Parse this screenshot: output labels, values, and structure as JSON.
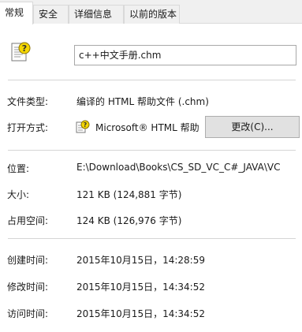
{
  "tabs": [
    "常规",
    "安全",
    "详细信息",
    "以前的版本"
  ],
  "file": {
    "name": "c++中文手册.chm"
  },
  "props": {
    "type_label": "文件类型:",
    "type_value": "编译的 HTML 帮助文件 (.chm)",
    "open_label": "打开方式:",
    "open_app": "Microsoft® HTML 帮助",
    "change_button": "更改(C)...",
    "location_label": "位置:",
    "location_value": "E:\\Download\\Books\\CS_SD_VC_C#_JAVA\\VC",
    "size_label": "大小:",
    "size_value": "121 KB (124,881 字节)",
    "disk_label": "占用空间:",
    "disk_value": "124 KB (126,976 字节)",
    "created_label": "创建时间:",
    "created_value": "2015年10月15日，14:28:59",
    "modified_label": "修改时间:",
    "modified_value": "2015年10月15日，14:34:52",
    "accessed_label": "访问时间:",
    "accessed_value": "2015年10月15日，14:34:52"
  },
  "icons": {
    "file": "chm-help-file-icon",
    "app": "html-help-app-icon"
  }
}
